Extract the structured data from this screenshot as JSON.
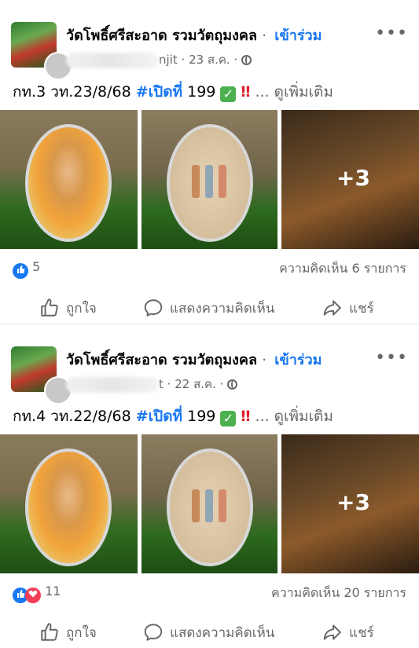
{
  "posts": [
    {
      "group_name": "วัดโพธิ์ศรีสะอาด รวมวัตถุมงคล",
      "separator": "·",
      "join_label": "เข้าร่วม",
      "more_label": "•••",
      "author_suffix": "njit",
      "date": "23 ส.ค.",
      "caption_prefix": "กท.3  วท.23/8/68",
      "hashtag": "#เปิดที่",
      "caption_number": "199",
      "check_emoji": "✓",
      "bang_emoji": "‼",
      "see_more": "... ดูเพิ่มเติม",
      "extra_photos": "+3",
      "reaction_count": "5",
      "comments_text": "ความคิดเห็น 6 รายการ",
      "like_label": "ถูกใจ",
      "comment_label": "แสดงความคิดเห็น",
      "share_label": "แชร์"
    },
    {
      "group_name": "วัดโพธิ์ศรีสะอาด รวมวัตถุมงคล",
      "separator": "·",
      "join_label": "เข้าร่วม",
      "more_label": "•••",
      "author_suffix": "t",
      "date": "22 ส.ค.",
      "caption_prefix": "กท.4  วท.22/8/68",
      "hashtag": "#เปิดที่",
      "caption_number": "199",
      "check_emoji": "✓",
      "bang_emoji": "‼",
      "see_more": "... ดูเพิ่มเติม",
      "extra_photos": "+3",
      "reaction_count": "11",
      "comments_text": "ความคิดเห็น 20 รายการ",
      "like_label": "ถูกใจ",
      "comment_label": "แสดงความคิดเห็น",
      "share_label": "แชร์"
    }
  ],
  "colors": {
    "accent": "#1877f2",
    "secondary_text": "#65676b",
    "like": "#1877f2",
    "love": "#f33e58"
  },
  "icons": [
    "globe-icon",
    "like-icon",
    "comment-icon",
    "share-icon",
    "more-icon",
    "like-reaction-icon",
    "love-reaction-icon"
  ]
}
